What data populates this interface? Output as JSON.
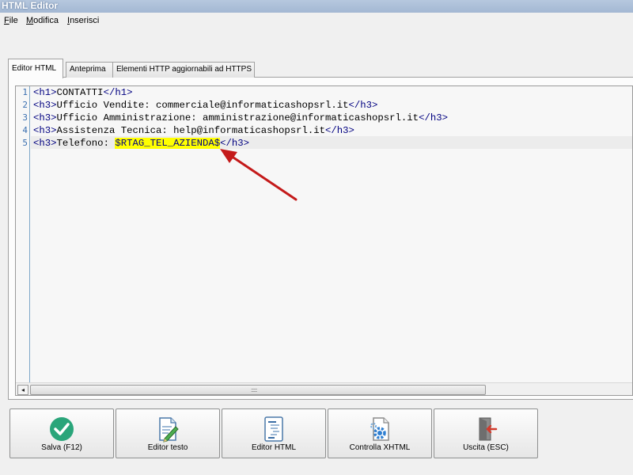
{
  "window": {
    "title": "HTML Editor"
  },
  "menu": [
    {
      "first": "F",
      "rest": "ile"
    },
    {
      "first": "M",
      "rest": "odifica"
    },
    {
      "first": "I",
      "rest": "nserisci"
    }
  ],
  "tabs": [
    "Editor HTML",
    "Anteprima",
    "Elementi HTTP aggiornabili ad HTTPS"
  ],
  "editor": {
    "line_numbers": [
      "1",
      "2",
      "3",
      "4",
      "5"
    ],
    "lines": [
      {
        "open": "<h1>",
        "text": "CONTATTI",
        "close": "</h1>"
      },
      {
        "open": "<h3>",
        "text": "Ufficio Vendite: commerciale@informaticashopsrl.it",
        "close": "</h3>"
      },
      {
        "open": "<h3>",
        "text": "Ufficio Amministrazione: amministrazione@informaticashopsrl.it",
        "close": "</h3>"
      },
      {
        "open": "<h3>",
        "text": "Assistenza Tecnica: help@informaticashopsrl.it",
        "close": "</h3>"
      },
      {
        "open": "<h3>",
        "text": "Telefono: ",
        "highlight": "$RTAG_TEL_AZIENDA$",
        "close": "</h3>"
      }
    ],
    "scroll_left_glyph": "◂",
    "scroll_grip": "::::::::"
  },
  "buttons": [
    {
      "label": "Salva (F12)",
      "icon": "check-icon"
    },
    {
      "label": "Editor testo",
      "icon": "edit-document-icon"
    },
    {
      "label": "Editor HTML",
      "icon": "html-document-icon"
    },
    {
      "label": "Controlla XHTML",
      "icon": "gear-document-icon"
    },
    {
      "label": "Uscita (ESC)",
      "icon": "exit-door-icon"
    }
  ],
  "colors": {
    "tag": "#000080",
    "highlight": "#ffff00",
    "line_numbers": "#3a6fb0",
    "arrow": "#c41a1a",
    "check": "#2aa57a"
  }
}
